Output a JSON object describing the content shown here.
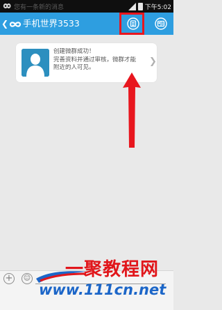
{
  "status_bar": {
    "time": "下午5:02",
    "ghost_text": "您有一条新的消息"
  },
  "header": {
    "title": "手机世界3533"
  },
  "group_card": {
    "lines": [
      "创建微群成功！",
      "完善资料并通过审核，微群才能",
      "附近的人可见。"
    ]
  },
  "annotation": {
    "color": "#e8161e"
  },
  "watermark": {
    "top_text": "一聚教程网",
    "url_text": "www.111cn.net"
  },
  "colors": {
    "title_bar": "#2e9ee0",
    "background": "#e9e9e9",
    "watermark_red": "#e1161b",
    "watermark_blue": "#1c66c8"
  },
  "icons": {
    "back": "chevron-left-icon",
    "logo": "infinity-logo-icon",
    "list": "list-icon",
    "profile": "contact-card-icon",
    "avatar": "person-avatar-icon",
    "plus": "plus-icon",
    "emoji": "smiley-icon"
  }
}
